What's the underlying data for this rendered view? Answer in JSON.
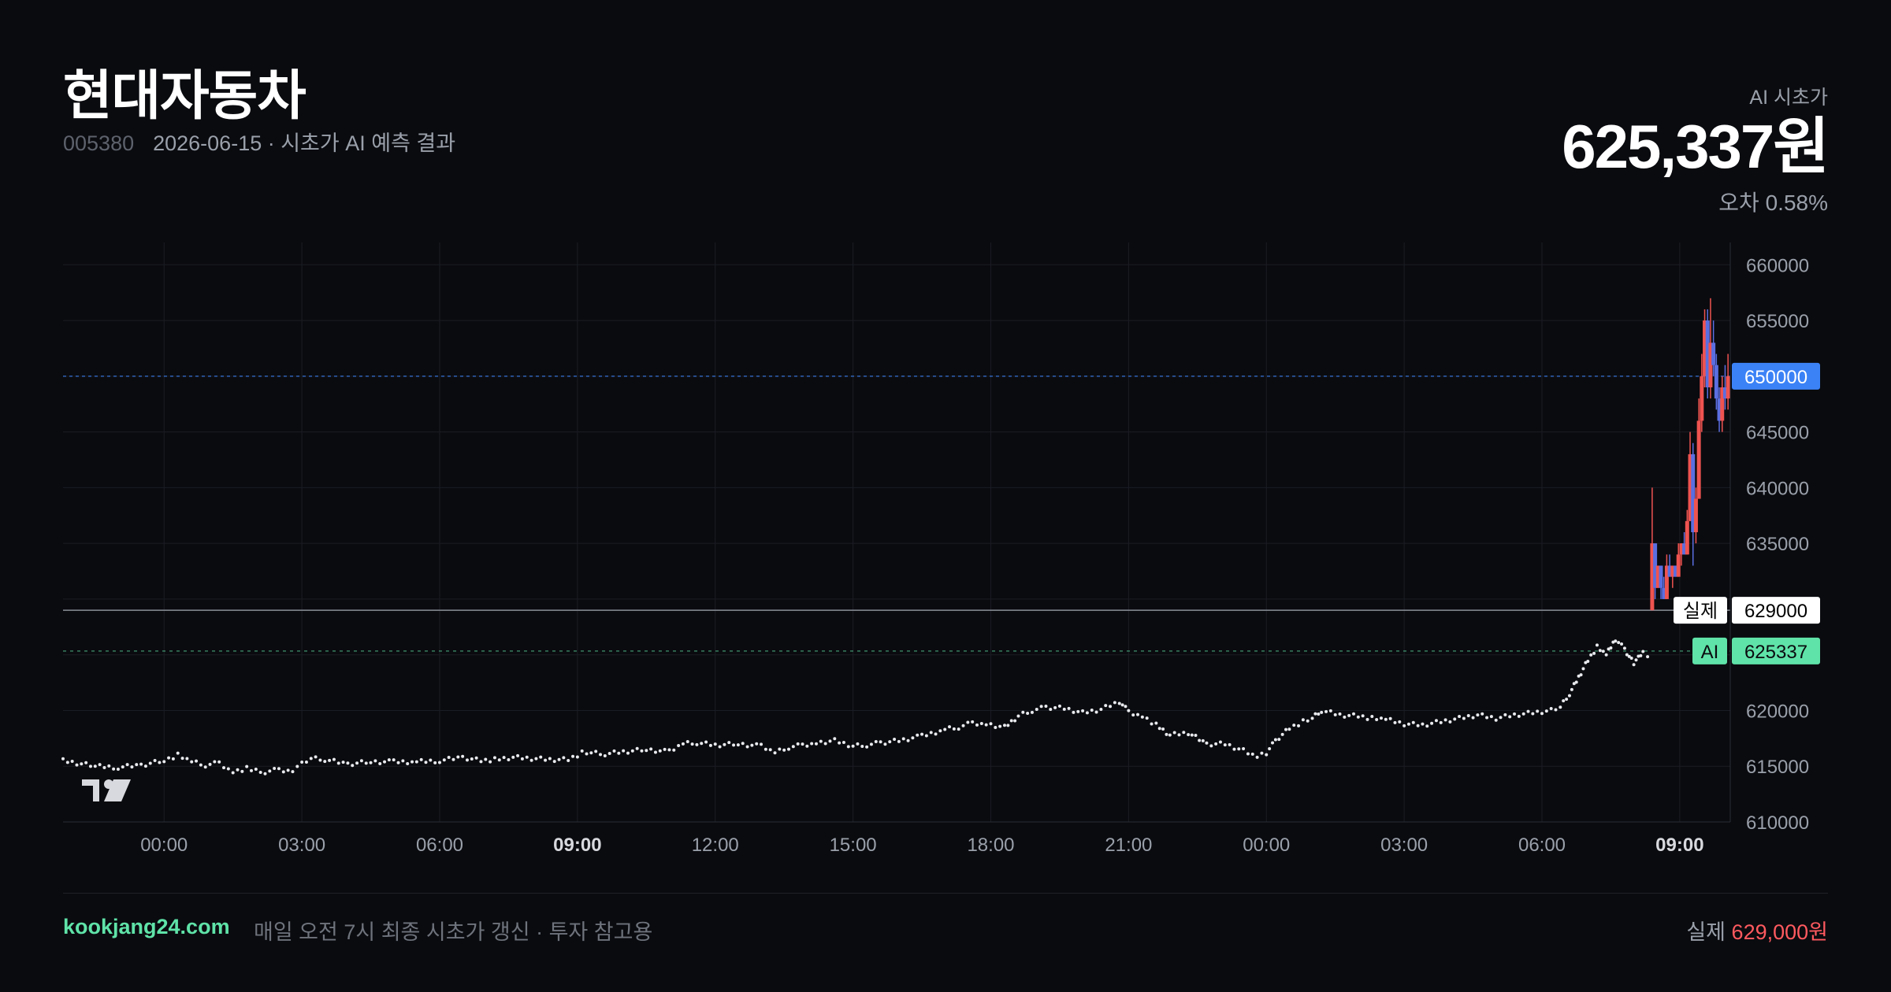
{
  "header": {
    "title": "현대자동차",
    "code": "005380",
    "subtitle": "2026-06-15 · 시초가 AI 예측 결과",
    "ai_label": "AI 시초가",
    "ai_price": "625,337원",
    "error_text": "오차 0.58%"
  },
  "footer": {
    "brand": "kookjang24.com",
    "note": "매일 오전 7시 최종 시초가 갱신 · 투자 참고용",
    "actual_label": "실제",
    "actual_value": "629,000원"
  },
  "colors": {
    "background": "#0a0b0f",
    "accent_green": "#5fe3a8",
    "up_red": "#ef5350",
    "down_blue": "#5b6ee1",
    "tag_blue": "#3b82f6",
    "grid": "#1a1d24",
    "text_muted": "#9aa0aa"
  },
  "icons": {
    "logo": "tradingview-logo-icon"
  },
  "chart_data": {
    "type": "line",
    "ylim": [
      610000,
      662000
    ],
    "y_ticks": [
      610000,
      615000,
      620000,
      625000,
      630000,
      635000,
      640000,
      645000,
      650000,
      655000,
      660000
    ],
    "y_tick_labels": [
      "610000",
      "615000",
      "620000",
      "",
      "",
      "635000",
      "640000",
      "645000",
      "650000",
      "655000",
      "660000"
    ],
    "x_ticks": [
      {
        "label": "00:00",
        "t": 0,
        "bold": false
      },
      {
        "label": "03:00",
        "t": 3,
        "bold": false
      },
      {
        "label": "06:00",
        "t": 6,
        "bold": false
      },
      {
        "label": "09:00",
        "t": 9,
        "bold": true
      },
      {
        "label": "12:00",
        "t": 12,
        "bold": false
      },
      {
        "label": "15:00",
        "t": 15,
        "bold": false
      },
      {
        "label": "18:00",
        "t": 18,
        "bold": false
      },
      {
        "label": "21:00",
        "t": 21,
        "bold": false
      },
      {
        "label": "00:00",
        "t": 24,
        "bold": false
      },
      {
        "label": "03:00",
        "t": 27,
        "bold": false
      },
      {
        "label": "06:00",
        "t": 30,
        "bold": false
      },
      {
        "label": "09:00",
        "t": 33,
        "bold": true
      }
    ],
    "xlim_hours": [
      -2.2,
      34.1
    ],
    "reference_lines": [
      {
        "name": "blue-level",
        "value": 650000,
        "tag": "650000",
        "color": "#3b82f6"
      },
      {
        "name": "actual",
        "value": 629000,
        "label": "실제",
        "tag": "629000",
        "color": "#9aa0aa"
      },
      {
        "name": "ai",
        "value": 625337,
        "label": "AI",
        "tag": "625337",
        "color": "#5fe3a8"
      }
    ],
    "series": [
      {
        "type": "dotted-line",
        "x_hours": [
          -2.2,
          -1.5,
          -1,
          -0.5,
          0,
          0.3,
          0.6,
          0.9,
          1.2,
          1.5,
          1.8,
          1.9,
          2.2,
          2.5,
          2.8,
          3.0,
          3.2,
          3.5,
          4.0,
          4.5,
          5,
          5.5,
          6,
          6.5,
          6.9,
          7.2,
          7.6,
          8,
          8.4,
          8.8,
          9.1,
          9.3,
          9.6,
          10,
          10.5,
          11,
          11.3,
          11.6,
          12,
          12.5,
          13,
          13.3,
          13.6,
          13.9,
          14.2,
          14.6,
          15,
          15.3,
          15.6,
          16,
          16.5,
          17,
          17.3,
          17.6,
          17.9,
          18.3,
          18.6,
          18.9,
          19.2,
          19.6,
          20,
          20.4,
          20.8,
          21.0,
          21.3,
          21.6,
          21.9,
          22.3,
          22.7,
          23.1,
          23.5,
          23.8,
          24.0,
          24.2,
          24.5,
          24.8,
          25.0,
          25.2,
          25.6,
          26,
          26.3,
          26.6,
          27,
          27.4,
          27.8,
          28.2,
          28.6,
          29,
          29.4,
          29.8,
          30.2,
          30.4,
          30.6,
          30.8,
          31.0,
          31.2,
          31.4,
          31.6,
          31.8,
          32.0,
          32.1,
          32.2,
          32.3,
          32.4
        ],
        "values": [
          615500,
          615000,
          614900,
          615100,
          615500,
          616000,
          615400,
          615100,
          615300,
          614500,
          614800,
          614600,
          614500,
          614700,
          614600,
          615200,
          615700,
          615600,
          615200,
          615400,
          615400,
          615400,
          615500,
          615800,
          615500,
          615600,
          615800,
          615700,
          615600,
          615600,
          616200,
          616200,
          616100,
          616300,
          616500,
          616300,
          617000,
          617100,
          616900,
          617000,
          616800,
          616200,
          616700,
          616900,
          617100,
          617300,
          616800,
          616900,
          617100,
          617300,
          617700,
          618300,
          618500,
          618900,
          618800,
          618500,
          619500,
          620000,
          620300,
          620200,
          619800,
          620100,
          620800,
          619900,
          619500,
          618700,
          617800,
          618000,
          617000,
          617000,
          616400,
          615800,
          616200,
          617300,
          618400,
          619000,
          619300,
          620000,
          619600,
          619500,
          619300,
          619200,
          618800,
          618700,
          619000,
          619300,
          619600,
          619300,
          619600,
          619800,
          620000,
          620300,
          621500,
          623000,
          624500,
          625700,
          625000,
          626400,
          625500,
          624200,
          624700,
          625300,
          625000,
          624700
        ]
      },
      {
        "type": "candlestick",
        "start_hour": 32.4,
        "step_hours": 0.0635,
        "ohlc": [
          [
            629000,
            640000,
            629000,
            635000
          ],
          [
            635000,
            635000,
            630000,
            631000
          ],
          [
            631000,
            633000,
            631000,
            633000
          ],
          [
            633000,
            633000,
            630000,
            631000
          ],
          [
            631000,
            632000,
            630000,
            630000
          ],
          [
            630000,
            634000,
            630000,
            633000
          ],
          [
            633000,
            634000,
            632000,
            632000
          ],
          [
            632000,
            633000,
            631000,
            633000
          ],
          [
            633000,
            633000,
            632000,
            632000
          ],
          [
            632000,
            635000,
            632000,
            634000
          ],
          [
            634000,
            635000,
            633000,
            635000
          ],
          [
            635000,
            636000,
            634000,
            634000
          ],
          [
            634000,
            638000,
            634000,
            637000
          ],
          [
            637000,
            645000,
            637000,
            643000
          ],
          [
            643000,
            644000,
            633000,
            636000
          ],
          [
            636000,
            640000,
            635000,
            639000
          ],
          [
            639000,
            648000,
            639000,
            646000
          ],
          [
            646000,
            652000,
            645000,
            650000
          ],
          [
            650000,
            656000,
            649000,
            655000
          ],
          [
            655000,
            656000,
            648000,
            649000
          ],
          [
            649000,
            657000,
            648000,
            653000
          ],
          [
            653000,
            655000,
            650000,
            651000
          ],
          [
            651000,
            652000,
            647000,
            648000
          ],
          [
            648000,
            649000,
            645000,
            646000
          ],
          [
            646000,
            650000,
            645000,
            649000
          ],
          [
            649000,
            651000,
            647000,
            648000
          ],
          [
            648000,
            652000,
            647000,
            650000
          ]
        ]
      }
    ]
  }
}
